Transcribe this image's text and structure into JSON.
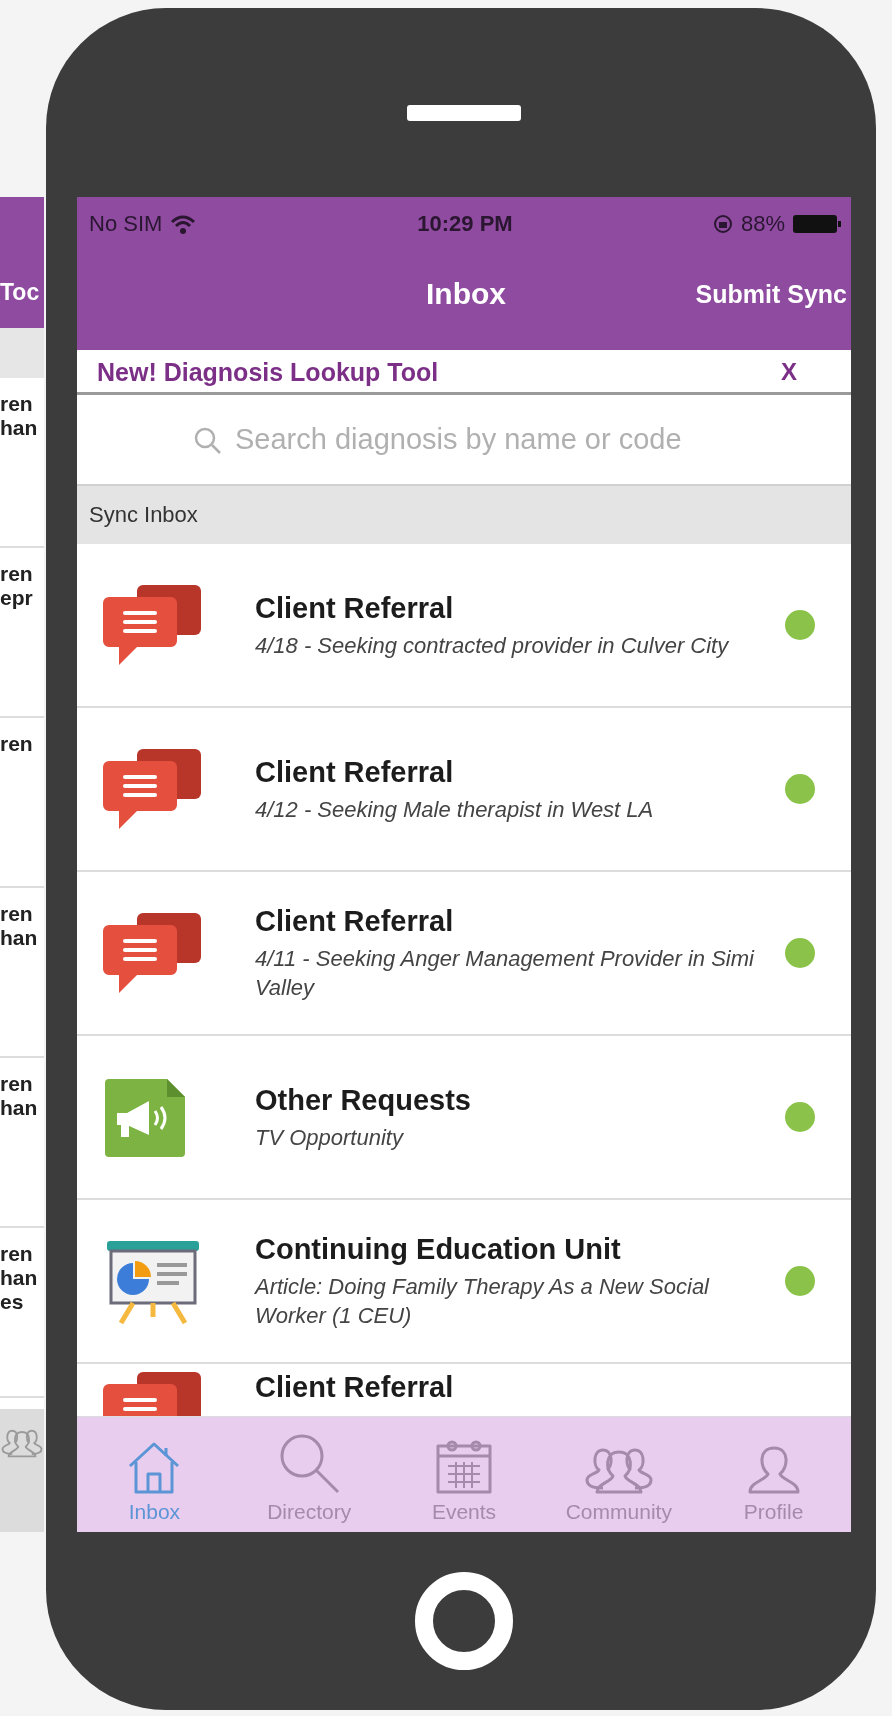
{
  "background_screen": {
    "title": "Toc",
    "rows": [
      {
        "lines": [
          "ren",
          "han"
        ]
      },
      {
        "lines": [
          "ren",
          "epr"
        ]
      },
      {
        "lines": [
          "ren"
        ]
      },
      {
        "lines": [
          "ren",
          "han"
        ]
      },
      {
        "lines": [
          "ren",
          "han"
        ]
      },
      {
        "lines": [
          "ren",
          "han",
          "es"
        ]
      }
    ]
  },
  "status_bar": {
    "carrier": "No SIM",
    "time": "10:29 PM",
    "battery": "88%"
  },
  "nav_bar": {
    "title": "Inbox",
    "action": "Submit Sync"
  },
  "banner": {
    "text": "New! Diagnosis Lookup Tool",
    "close": "X"
  },
  "search": {
    "placeholder": "Search diagnosis by name or code"
  },
  "section": {
    "title": "Sync Inbox"
  },
  "messages": [
    {
      "kind": "referral",
      "title": "Client Referral",
      "subtitle": "4/18 - Seeking contracted provider in Culver City",
      "unread": true
    },
    {
      "kind": "referral",
      "title": "Client Referral",
      "subtitle": "4/12 - Seeking Male therapist in West LA",
      "unread": true
    },
    {
      "kind": "referral",
      "title": "Client Referral",
      "subtitle": "4/11 - Seeking Anger Management Provider in Simi Valley",
      "unread": true
    },
    {
      "kind": "request",
      "title": "Other Requests",
      "subtitle": "TV Opportunity",
      "unread": true
    },
    {
      "kind": "education",
      "title": "Continuing Education Unit",
      "subtitle": "Article: Doing Family Therapy As a New Social Worker (1 CEU)",
      "unread": true
    }
  ],
  "partial_row": {
    "kind": "referral",
    "title": "Client Referral"
  },
  "tab_bar": [
    {
      "kind": "home",
      "label": "Inbox",
      "selected": true
    },
    {
      "kind": "search",
      "label": "Directory",
      "selected": false
    },
    {
      "kind": "calendar",
      "label": "Events",
      "selected": false
    },
    {
      "kind": "people",
      "label": "Community",
      "selected": false
    },
    {
      "kind": "person",
      "label": "Profile",
      "selected": false
    }
  ]
}
